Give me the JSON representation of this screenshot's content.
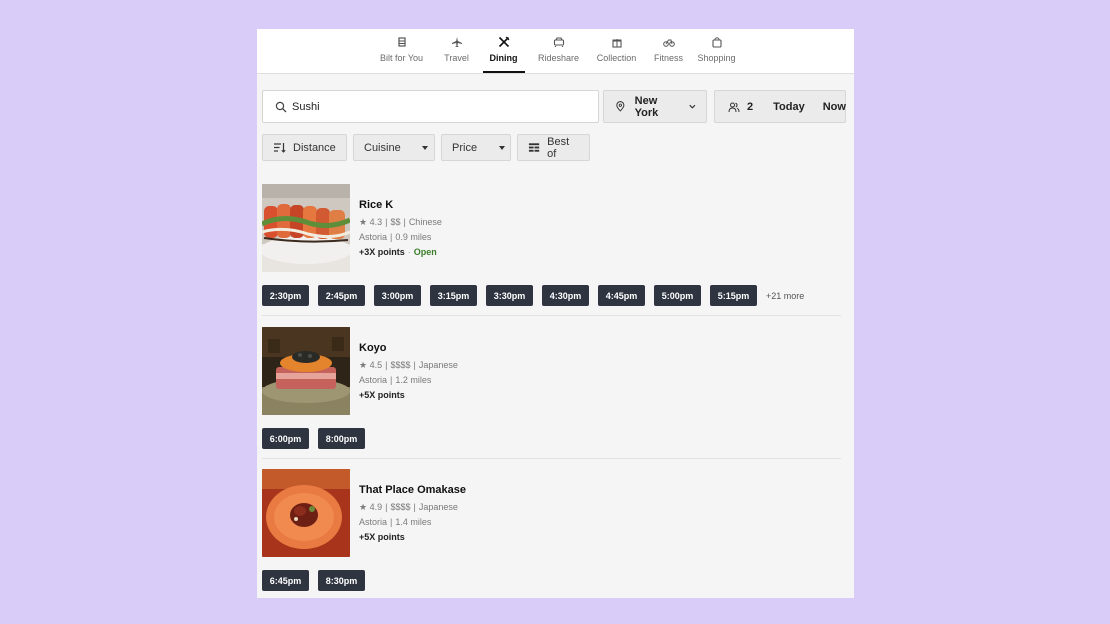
{
  "nav": {
    "tabs": [
      {
        "label": "Bilt for You",
        "icon": "bilt-icon",
        "active": false
      },
      {
        "label": "Travel",
        "icon": "airplane-icon",
        "active": false
      },
      {
        "label": "Dining",
        "icon": "utensils-icon",
        "active": true
      },
      {
        "label": "Rideshare",
        "icon": "car-icon",
        "active": false
      },
      {
        "label": "Collection",
        "icon": "gift-icon",
        "active": false
      },
      {
        "label": "Fitness",
        "icon": "bicycle-icon",
        "active": false
      },
      {
        "label": "Shopping",
        "icon": "shopping-bag-icon",
        "active": false
      }
    ]
  },
  "search": {
    "value": "Sushi",
    "icon": "search-icon"
  },
  "location": {
    "label": "New York",
    "icon": "map-pin-icon"
  },
  "party": {
    "size": "2",
    "date": "Today",
    "time": "Now",
    "icon": "people-icon"
  },
  "filters": {
    "distance": "Distance",
    "cuisine": "Cuisine",
    "price": "Price",
    "best_of": "Best of"
  },
  "results": [
    {
      "name": "Rice K",
      "rating": "4.3",
      "price": "$$",
      "cuisine": "Chinese",
      "neighborhood": "Astoria",
      "distance": "0.9 miles",
      "points": "+3X points",
      "status": "Open",
      "times": [
        "2:30pm",
        "2:45pm",
        "3:00pm",
        "3:15pm",
        "3:30pm",
        "4:30pm",
        "4:45pm",
        "5:00pm",
        "5:15pm"
      ],
      "more": "+21 more"
    },
    {
      "name": "Koyo",
      "rating": "4.5",
      "price": "$$$$",
      "cuisine": "Japanese",
      "neighborhood": "Astoria",
      "distance": "1.2 miles",
      "points": "+5X points",
      "times": [
        "6:00pm",
        "8:00pm"
      ]
    },
    {
      "name": "That Place Omakase",
      "rating": "4.9",
      "price": "$$$$",
      "cuisine": "Japanese",
      "neighborhood": "Astoria",
      "distance": "1.4 miles",
      "points": "+5X points",
      "times": [
        "6:45pm",
        "8:30pm"
      ]
    }
  ],
  "colors": {
    "background": "#d9ccf8",
    "slot": "#2e3440",
    "open": "#3a7d2a"
  }
}
